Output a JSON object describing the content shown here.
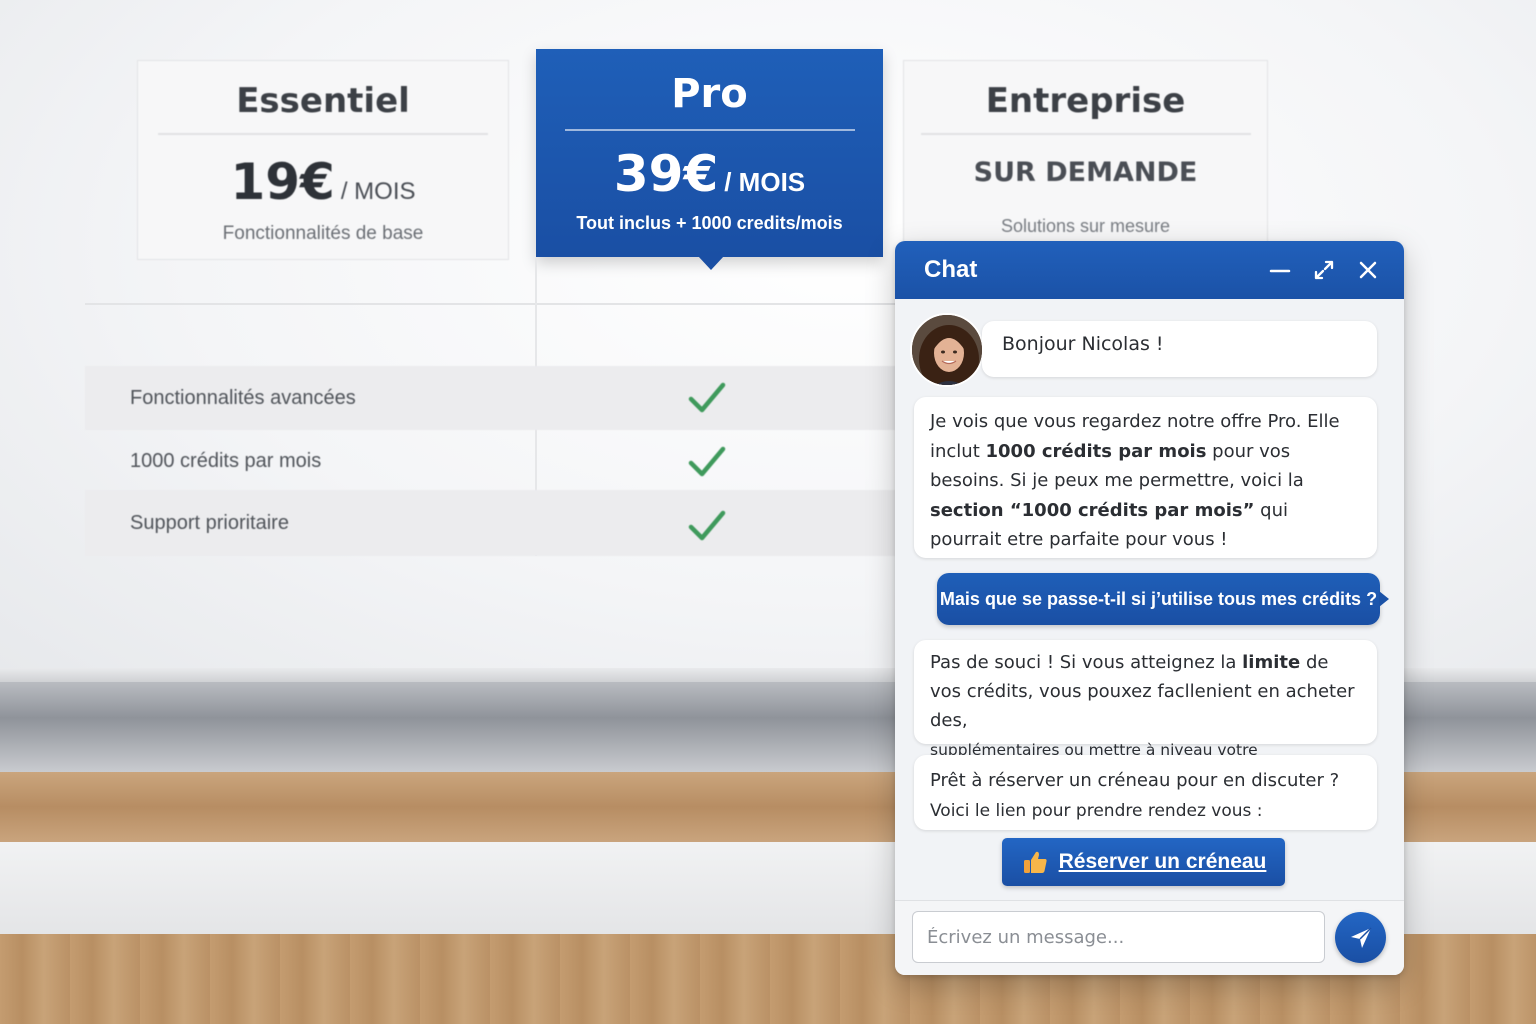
{
  "pricing": {
    "plans": [
      {
        "name": "Essentiel",
        "price": "19€",
        "unit": "/ MOIS",
        "description": "Fonctionnalités de base"
      },
      {
        "name": "Pro",
        "price": "39€",
        "unit": "/ MOIS",
        "description": "Tout inclus + 1000 credits/mois",
        "highlighted": true
      },
      {
        "name": "Entreprise",
        "price_text": "SUR DEMANDE",
        "description": "Solutions sur mesure"
      }
    ],
    "features": [
      {
        "label": "Fonctionnalités avancées",
        "pro_included": true
      },
      {
        "label": "1000 crédits par mois",
        "pro_included": true
      },
      {
        "label": "Support prioritaire",
        "pro_included": true
      }
    ]
  },
  "chat": {
    "title": "Chat",
    "header_icons": [
      "minimize-icon",
      "expand-icon",
      "close-icon"
    ],
    "messages": {
      "greeting": "Bonjour Nicolas !",
      "intro": {
        "p1": "Je vois que vous regardez notre offre Pro. Elle inclut ",
        "b1": "1000 crédits par mois",
        "p2": " pour vos besoins. Si je peux me permettre, voici la ",
        "b2": "section “1000 crédits par mois”",
        "p3": " qui pourrait etre parfaite pour vous !"
      },
      "user_question": "Mais que se passe-t-il si j’utilise tous mes crédits ?",
      "answer": {
        "p1": "Pas de souci ! Si vous atteignez la ",
        "b1": "limite",
        "p2": " de vos crédits, vous pouxez facllenient en acheter des,",
        "p3": "supplémentaires ou mettre à niveau votre abonıtement."
      },
      "booking": {
        "line1": "Prêt à réserver un créneau pour en discuter ?",
        "line2": "Voici le lien pour prendre rendez vous :"
      }
    },
    "book_button": {
      "label": "Réserver un créneau",
      "icon": "thumbs-up-icon"
    },
    "input": {
      "placeholder": "Écrivez un message...",
      "value": ""
    },
    "send_icon": "send-icon"
  },
  "colors": {
    "accent": "#1f5fb8",
    "check": "#3f9a5c"
  }
}
